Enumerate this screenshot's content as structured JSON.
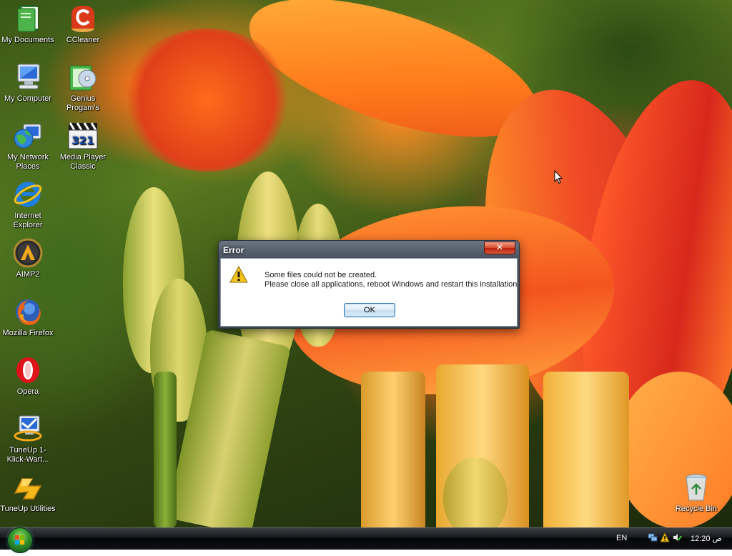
{
  "desktop": {
    "icons_left": [
      {
        "label": "My Documents",
        "icon": "folder-documents-icon"
      },
      {
        "label": "My Computer",
        "icon": "computer-icon"
      },
      {
        "label": "My Network Places",
        "icon": "network-globe-icon"
      },
      {
        "label": "Internet Explorer",
        "icon": "internet-explorer-icon"
      },
      {
        "label": "AIMP2",
        "icon": "aimp-icon"
      },
      {
        "label": "Mozilla Firefox",
        "icon": "firefox-icon"
      },
      {
        "label": "Opera",
        "icon": "opera-icon"
      },
      {
        "label": "TuneUp 1-Klick-Wart...",
        "icon": "tuneup-wartung-icon"
      },
      {
        "label": "TuneUp Utilities",
        "icon": "tuneup-utilities-icon"
      }
    ],
    "icons_second": [
      {
        "label": "CCleaner",
        "icon": "ccleaner-icon"
      },
      {
        "label": "Genius Progam's",
        "icon": "genius-program-icon"
      },
      {
        "label": "Media Player Classic",
        "icon": "media-player-classic-icon"
      }
    ],
    "recycle_bin": {
      "label": "Recycle Bin",
      "icon": "recycle-bin-icon"
    }
  },
  "dialog": {
    "title": "Error",
    "close_label": "✕",
    "message_line1": "Some files could not be created.",
    "message_line2": "Please close all applications, reboot Windows and restart this installation",
    "ok_label": "OK",
    "icon": "warning-icon"
  },
  "taskbar": {
    "language": "EN",
    "clock": "12:20 ص",
    "start_icon": "windows-start-orb-icon"
  },
  "colors": {
    "taskbar": "#0b0c0e",
    "dialog_frame": "#4a5360",
    "close_button": "#d64a2a",
    "wallpaper_orange": "#ff7a1a"
  }
}
